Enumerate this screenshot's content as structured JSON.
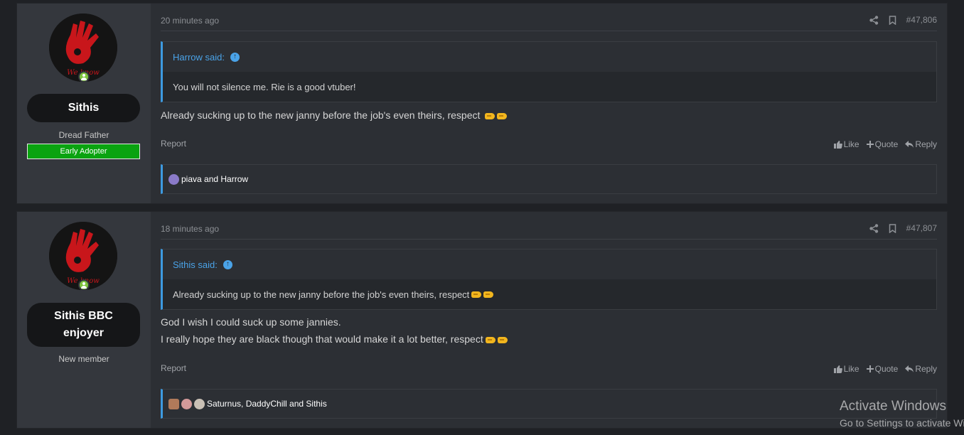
{
  "posts": [
    {
      "user": {
        "name": "Sithis",
        "title": "Dread Father",
        "banner": "Early Adopter",
        "avatar_text": "We know"
      },
      "time": "20 minutes ago",
      "post_number": "#47,806",
      "quote": {
        "author": "Harrow said:",
        "text": "You will not silence me. Rie is a good vtuber!"
      },
      "message": [
        "Already sucking up to the new janny before the job's even theirs, respect"
      ],
      "report_label": "Report",
      "actions": {
        "like": "Like",
        "quote": "Quote",
        "reply": "Reply"
      },
      "reactions": "piava and Harrow"
    },
    {
      "user": {
        "name": "Sithis BBC enjoyer",
        "title": "New member",
        "avatar_text": "We know"
      },
      "time": "18 minutes ago",
      "post_number": "#47,807",
      "quote": {
        "author": "Sithis said:",
        "text": "Already sucking up to the new janny before the job's even theirs, respect"
      },
      "message": [
        "God I wish I could suck up some jannies.",
        "I really hope they are black though that would make it a lot better, respect"
      ],
      "report_label": "Report",
      "actions": {
        "like": "Like",
        "quote": "Quote",
        "reply": "Reply"
      },
      "reactions": "Saturnus, DaddyChill and Sithis"
    }
  ],
  "icons": {
    "share": "share-icon",
    "bookmark": "bookmark-icon",
    "up_arrow": "arrow-up-circle-icon",
    "like": "thumbs-up-icon",
    "quote": "plus-icon",
    "reply": "reply-icon",
    "fist": "fist-bump-emoji"
  },
  "colors": {
    "accent": "#3d9ae0",
    "banner_green": "#0aa310",
    "online": "#7ec43d"
  },
  "watermark": {
    "line1": "Activate Windows",
    "line2": "Go to Settings to activate Windows."
  }
}
